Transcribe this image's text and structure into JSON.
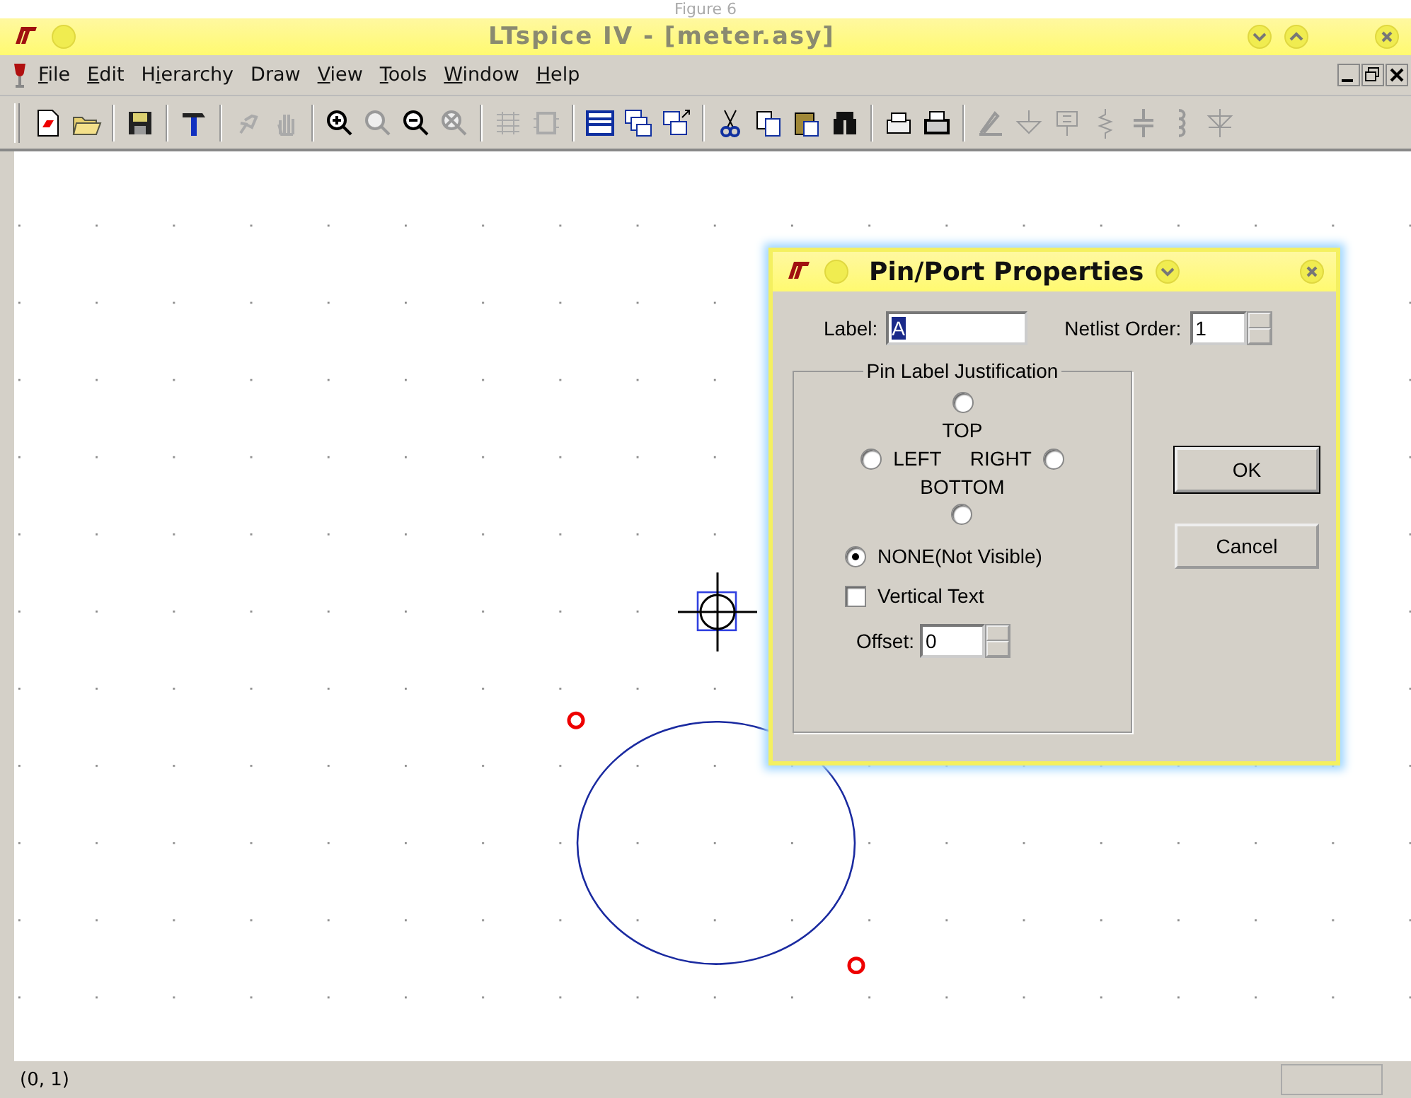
{
  "caption": "Figure 6",
  "window": {
    "title": "LTspice IV - [meter.asy]"
  },
  "menu": [
    {
      "key": "F",
      "after": "ile"
    },
    {
      "key": "E",
      "after": "dit"
    },
    {
      "before": "H",
      "key": "i",
      "after": "erarchy"
    },
    {
      "before": "Draw"
    },
    {
      "key": "V",
      "after": "iew"
    },
    {
      "key": "T",
      "after": "ools"
    },
    {
      "key": "W",
      "after": "indow"
    },
    {
      "key": "H",
      "after": "elp"
    }
  ],
  "dialog": {
    "title": "Pin/Port Properties",
    "label_caption": "Label:",
    "label_value": "A",
    "order_caption": "Netlist Order:",
    "order_value": "1",
    "group_title": "Pin Label Justification",
    "options": [
      {
        "kind": "top",
        "label": "TOP",
        "selected": false
      },
      {
        "kind": "left",
        "label": "LEFT",
        "selected": false
      },
      {
        "kind": "right",
        "label": "RIGHT",
        "selected": false
      },
      {
        "kind": "bottom",
        "label": "BOTTOM",
        "selected": false
      },
      {
        "kind": "none",
        "label": "NONE(Not Visible)",
        "selected": true
      }
    ],
    "vertical_text": {
      "label": "Vertical Text",
      "checked": false
    },
    "offset_caption": "Offset:",
    "offset_value": "0",
    "buttons": [
      {
        "label": "OK",
        "default": true
      },
      {
        "label": "Cancel",
        "default": false
      }
    ]
  },
  "status_bar": {
    "coords": "(0, 1)"
  }
}
